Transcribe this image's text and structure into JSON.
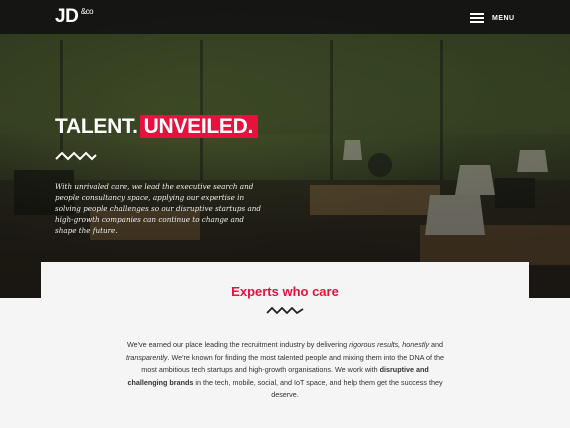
{
  "header": {
    "logo_main": "JD",
    "logo_sub": "&co",
    "menu_label": "MENU"
  },
  "hero": {
    "headline_1": "TALENT.",
    "headline_2": "UNVEILED.",
    "description": "With unrivaled care, we lead the executive search and people consultancy space, applying our expertise in solving people challenges so our disruptive startups and high-growth companies can continue to change and shape the future."
  },
  "experts": {
    "title": "Experts who care",
    "p1": "We've earned our place leading the recruitment industry by delivering ",
    "p1_em1": "rigorous results, honestly",
    "p1_and": " and ",
    "p1_em2": "transparently",
    "p2": ". We're known for finding the most talented people and mixing them into the DNA of the most ambitious tech startups and high-growth organisations. We work with ",
    "p2_strong": "disruptive and challenging brands",
    "p3": " in the tech, mobile, social, and IoT space, and help them get the success they deserve."
  },
  "colors": {
    "accent": "#e6123d",
    "topbar": "#141414"
  }
}
